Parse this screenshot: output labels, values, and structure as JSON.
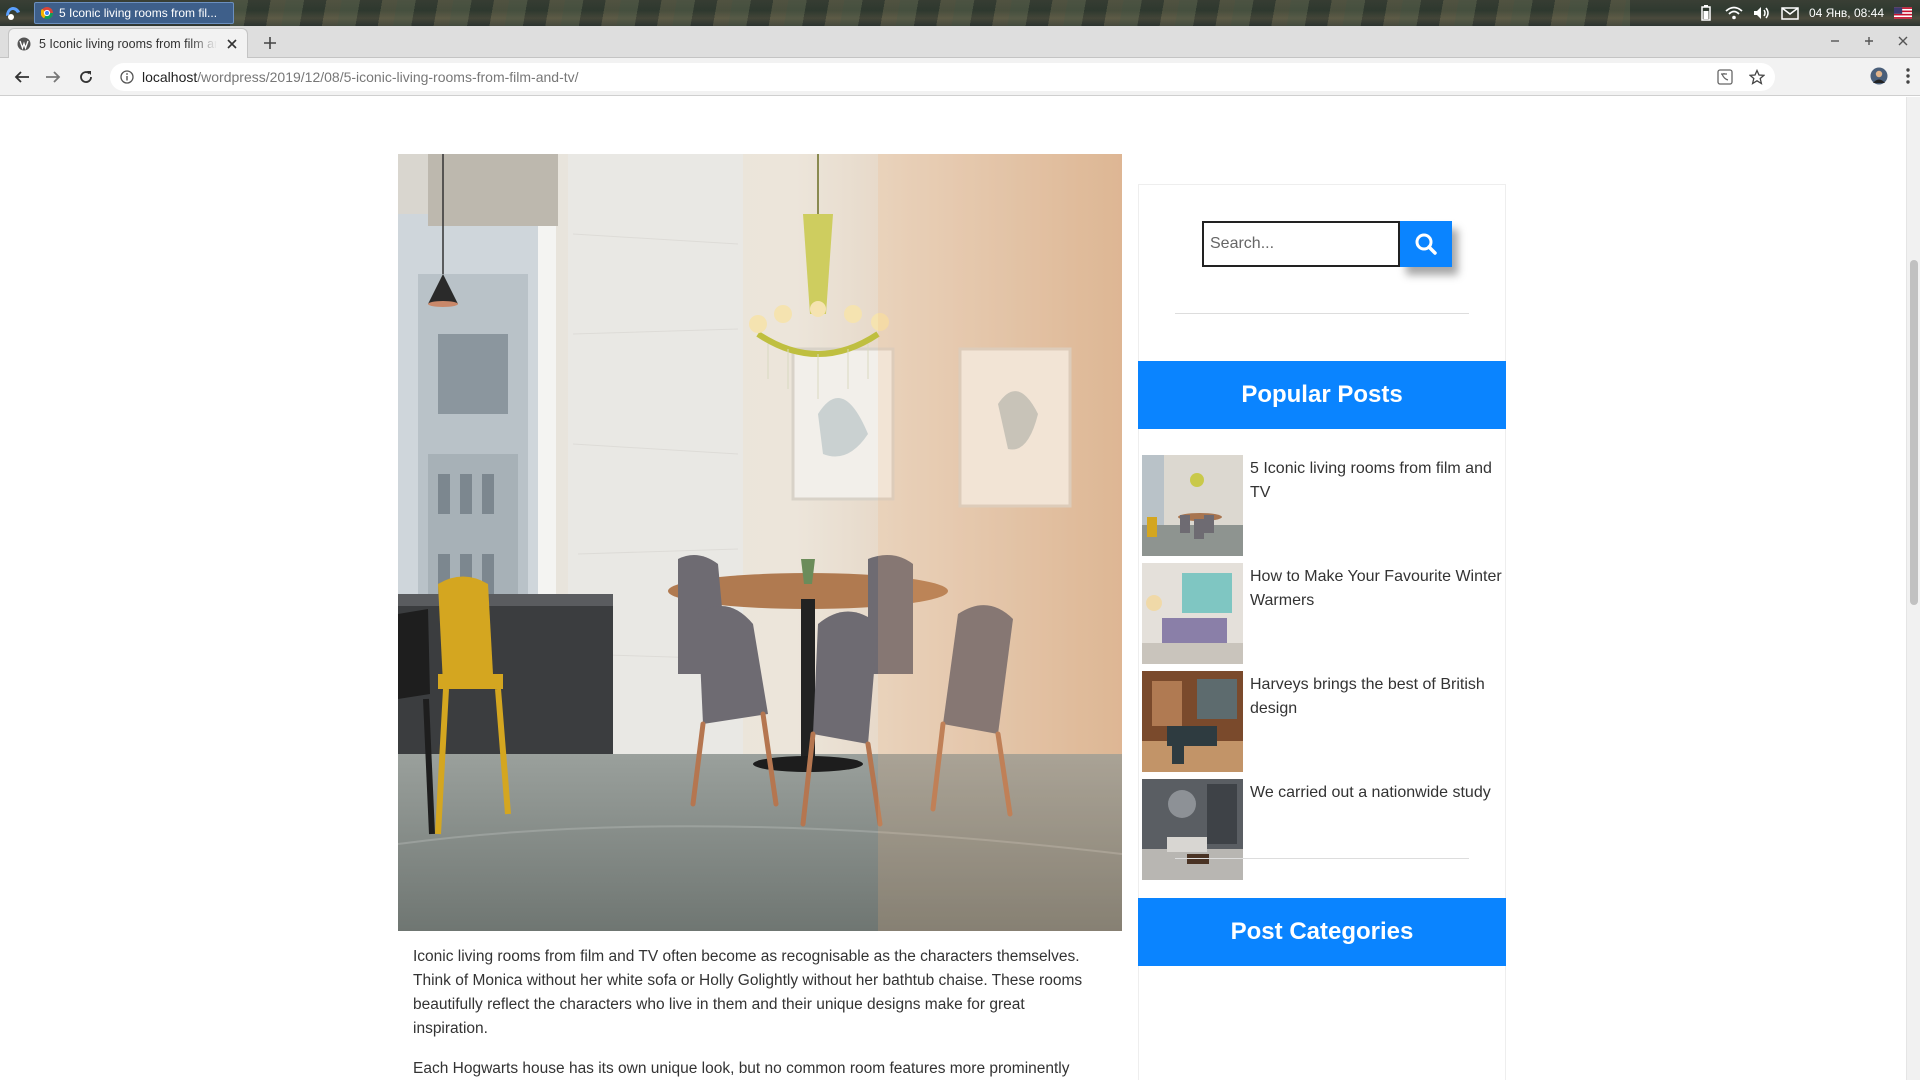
{
  "os": {
    "task_title": "5 Iconic living rooms from fil...",
    "clock": "04 Янв, 08:44"
  },
  "browser": {
    "tab_title": "5 Iconic living rooms from film and TV",
    "url_host": "localhost",
    "url_path": "/wordpress/2019/12/08/5-iconic-living-rooms-from-film-and-tv/"
  },
  "sidebar": {
    "search_placeholder": "Search...",
    "popular_title": "Popular Posts",
    "categories_title": "Post Categories",
    "posts": [
      {
        "title": "5 Iconic living rooms from film and TV"
      },
      {
        "title": "How to Make Your Favourite Winter Warmers"
      },
      {
        "title": "Harveys brings the best of British design"
      },
      {
        "title": "We carried out a nationwide study"
      }
    ]
  },
  "article": {
    "paragraphs": [
      "Iconic living rooms from film and TV often become as recognisable as the characters themselves. Think of Monica without her white sofa or Holly Golightly without her bathtub chaise. These rooms beautifully reflect the characters who live in them and their unique designs make for great inspiration.",
      "Each Hogwarts house has its own unique look, but no common room features more prominently"
    ]
  },
  "colors": {
    "accent": "#0a84ff",
    "text": "#333333"
  }
}
